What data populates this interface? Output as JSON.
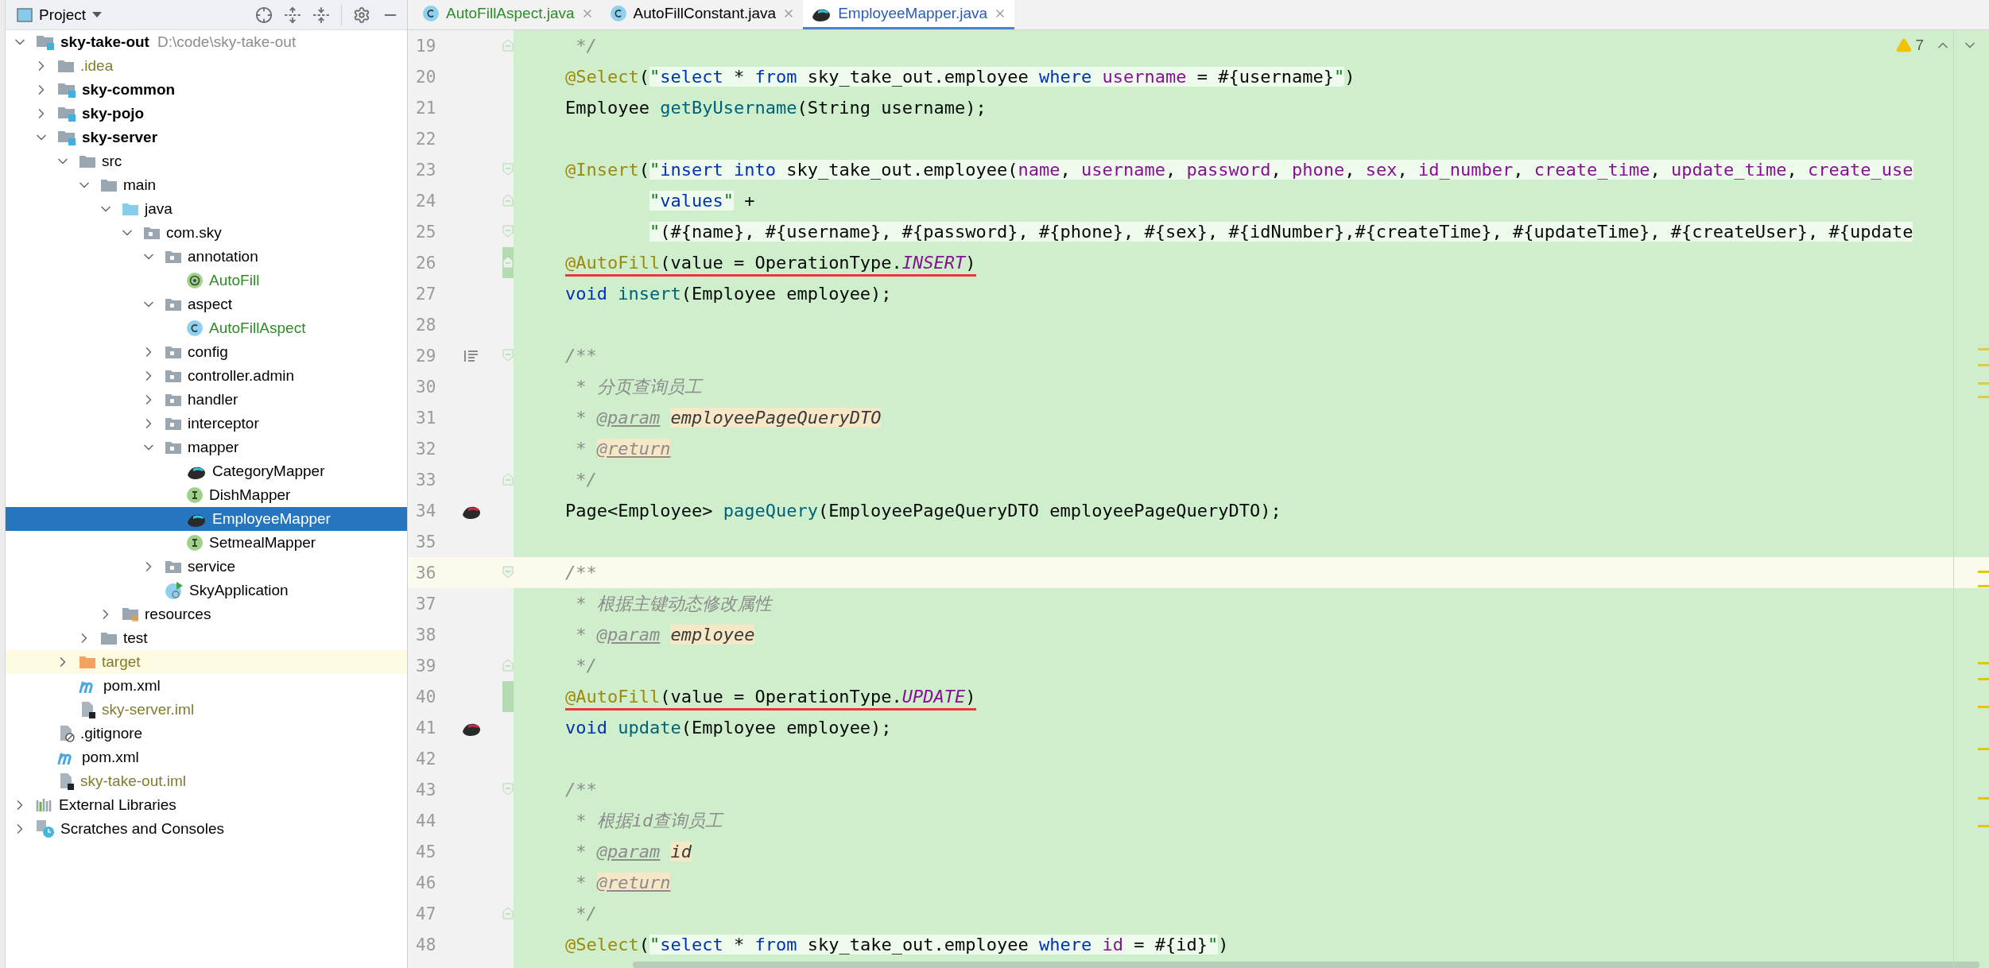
{
  "project_panel": {
    "title": "Project",
    "tree": [
      {
        "label": "sky-take-out",
        "location": "D:\\code\\sky-take-out",
        "kind": "module",
        "expanded": true,
        "selected": false,
        "children": [
          {
            "label": ".idea",
            "kind": "folder",
            "color": "#827b2d",
            "expanded": false,
            "selected": false
          },
          {
            "label": "sky-common",
            "kind": "module",
            "expanded": false,
            "selected": false
          },
          {
            "label": "sky-pojo",
            "kind": "module",
            "expanded": false,
            "selected": false
          },
          {
            "label": "sky-server",
            "kind": "module",
            "expanded": true,
            "selected": false,
            "children": [
              {
                "label": "src",
                "kind": "folder",
                "expanded": true,
                "selected": false,
                "children": [
                  {
                    "label": "main",
                    "kind": "folder",
                    "expanded": true,
                    "selected": false,
                    "children": [
                      {
                        "label": "java",
                        "kind": "source",
                        "expanded": true,
                        "selected": false,
                        "children": [
                          {
                            "label": "com.sky",
                            "kind": "package",
                            "expanded": true,
                            "selected": false,
                            "children": [
                              {
                                "label": "annotation",
                                "kind": "package",
                                "expanded": true,
                                "selected": false,
                                "children": [
                                  {
                                    "label": "AutoFill",
                                    "kind": "annotation",
                                    "color": "#2f8a2a",
                                    "selected": false
                                  }
                                ]
                              },
                              {
                                "label": "aspect",
                                "kind": "package",
                                "expanded": true,
                                "selected": false,
                                "children": [
                                  {
                                    "label": "AutoFillAspect",
                                    "kind": "class",
                                    "color": "#2f8a2a",
                                    "selected": false
                                  }
                                ]
                              },
                              {
                                "label": "config",
                                "kind": "package",
                                "expanded": false,
                                "selected": false
                              },
                              {
                                "label": "controller.admin",
                                "kind": "package",
                                "expanded": false,
                                "selected": false
                              },
                              {
                                "label": "handler",
                                "kind": "package",
                                "expanded": false,
                                "selected": false
                              },
                              {
                                "label": "interceptor",
                                "kind": "package",
                                "expanded": false,
                                "selected": false
                              },
                              {
                                "label": "mapper",
                                "kind": "package",
                                "expanded": true,
                                "selected": false,
                                "children": [
                                  {
                                    "label": "CategoryMapper",
                                    "kind": "mapper",
                                    "selected": false
                                  },
                                  {
                                    "label": "DishMapper",
                                    "kind": "interface",
                                    "selected": false
                                  },
                                  {
                                    "label": "EmployeeMapper",
                                    "kind": "mapper",
                                    "selected": true
                                  },
                                  {
                                    "label": "SetmealMapper",
                                    "kind": "interface",
                                    "selected": false
                                  }
                                ]
                              },
                              {
                                "label": "service",
                                "kind": "package",
                                "expanded": false,
                                "selected": false
                              },
                              {
                                "label": "SkyApplication",
                                "kind": "main",
                                "selected": false
                              }
                            ]
                          }
                        ]
                      },
                      {
                        "label": "resources",
                        "kind": "resources",
                        "expanded": false,
                        "selected": false
                      }
                    ]
                  },
                  {
                    "label": "test",
                    "kind": "folder",
                    "expanded": false,
                    "selected": false
                  }
                ]
              },
              {
                "label": "target",
                "kind": "excluded",
                "color": "#827b2d",
                "expanded": false,
                "selected": false
              },
              {
                "label": "pom.xml",
                "kind": "maven",
                "selected": false
              },
              {
                "label": "sky-server.iml",
                "kind": "iml",
                "color": "#827b2d",
                "selected": false
              }
            ]
          },
          {
            "label": ".gitignore",
            "kind": "gitignore",
            "selected": false
          },
          {
            "label": "pom.xml",
            "kind": "maven",
            "selected": false
          },
          {
            "label": "sky-take-out.iml",
            "kind": "iml",
            "color": "#827b2d",
            "selected": false
          }
        ]
      },
      {
        "label": "External Libraries",
        "kind": "libraries",
        "expanded": false,
        "selected": false
      },
      {
        "label": "Scratches and Consoles",
        "kind": "scratches",
        "expanded": false,
        "selected": false
      }
    ]
  },
  "editor": {
    "tabs": [
      {
        "label": "AutoFillAspect.java",
        "kind": "class",
        "color": "#2f8a2a",
        "selected": false
      },
      {
        "label": "AutoFillConstant.java",
        "kind": "class",
        "selected": false
      },
      {
        "label": "EmployeeMapper.java",
        "kind": "mapper",
        "color": "#2a5cb6",
        "selected": true
      }
    ],
    "warning_count": "7",
    "lines": [
      {
        "number": "19",
        "current": false,
        "modified": false,
        "fold_start": false,
        "fold_end": true,
        "mapped": false,
        "render_toggle": false,
        "tokens": [
          {
            "kind": "cmt",
            "text": "     */"
          }
        ]
      },
      {
        "number": "20",
        "current": false,
        "modified": false,
        "fold_start": false,
        "fold_end": false,
        "mapped": false,
        "render_toggle": false,
        "tokens": [
          {
            "kind": "ann",
            "text": "    @Select"
          },
          {
            "kind": "plain",
            "text": "("
          },
          {
            "kind": "str",
            "text": "\""
          },
          {
            "kind": "sqlkw",
            "text": "select"
          },
          {
            "kind": "sql",
            "text": " * "
          },
          {
            "kind": "sqlkw",
            "text": "from"
          },
          {
            "kind": "sql",
            "text": " sky_take_out.employee "
          },
          {
            "kind": "sqlkw",
            "text": "where"
          },
          {
            "kind": "col",
            "text": " username"
          },
          {
            "kind": "sql",
            "text": " = #{username}"
          },
          {
            "kind": "str",
            "text": "\""
          },
          {
            "kind": "plain",
            "text": ")"
          }
        ]
      },
      {
        "number": "21",
        "current": false,
        "modified": false,
        "fold_start": false,
        "fold_end": false,
        "mapped": false,
        "render_toggle": false,
        "tokens": [
          {
            "kind": "plain",
            "text": "    Employee "
          },
          {
            "kind": "fn",
            "text": "getByUsername"
          },
          {
            "kind": "plain",
            "text": "(String username);"
          }
        ]
      },
      {
        "number": "22",
        "current": false,
        "modified": false,
        "fold_start": false,
        "fold_end": false,
        "mapped": false,
        "render_toggle": false
      },
      {
        "number": "23",
        "current": false,
        "modified": false,
        "fold_start": true,
        "fold_end": false,
        "mapped": false,
        "render_toggle": false,
        "tokens": [
          {
            "kind": "ann",
            "text": "    @Insert"
          },
          {
            "kind": "plain",
            "text": "("
          },
          {
            "kind": "str",
            "text": "\""
          },
          {
            "kind": "sqlkw",
            "text": "insert into"
          },
          {
            "kind": "sql",
            "text": " sky_take_out.employee("
          },
          {
            "kind": "col",
            "text": "name"
          },
          {
            "kind": "sql",
            "text": ", "
          },
          {
            "kind": "col",
            "text": "username"
          },
          {
            "kind": "sql",
            "text": ", "
          },
          {
            "kind": "col",
            "text": "password"
          },
          {
            "kind": "sql",
            "text": ", "
          },
          {
            "kind": "col",
            "text": "phone"
          },
          {
            "kind": "sql",
            "text": ", "
          },
          {
            "kind": "col",
            "text": "sex"
          },
          {
            "kind": "sql",
            "text": ", "
          },
          {
            "kind": "col",
            "text": "id_number"
          },
          {
            "kind": "sql",
            "text": ", "
          },
          {
            "kind": "col",
            "text": "create_time"
          },
          {
            "kind": "sql",
            "text": ", "
          },
          {
            "kind": "col",
            "text": "update_time"
          },
          {
            "kind": "sql",
            "text": ", "
          },
          {
            "kind": "col",
            "text": "create_use"
          }
        ]
      },
      {
        "number": "24",
        "current": false,
        "modified": false,
        "fold_start": false,
        "fold_end": true,
        "mapped": false,
        "render_toggle": false,
        "tokens": [
          {
            "kind": "str",
            "text": "            \""
          },
          {
            "kind": "sqlkw",
            "text": "values"
          },
          {
            "kind": "str",
            "text": "\""
          },
          {
            "kind": "plain",
            "text": " +"
          }
        ]
      },
      {
        "number": "25",
        "current": false,
        "modified": false,
        "fold_start": true,
        "fold_end": false,
        "mapped": false,
        "render_toggle": false,
        "tokens": [
          {
            "kind": "str",
            "text": "            \""
          },
          {
            "kind": "sql",
            "text": "(#{name}, #{username}, #{password}, #{phone}, #{sex}, #{idNumber},#{createTime}, #{updateTime}, #{createUser}, #{update"
          }
        ]
      },
      {
        "number": "26",
        "current": false,
        "modified": true,
        "underlined": true,
        "fold_start": false,
        "fold_end": true,
        "mapped": false,
        "render_toggle": false,
        "tokens": [
          {
            "kind": "ann",
            "text": "    @AutoFill"
          },
          {
            "kind": "plain",
            "text": "(value = OperationType."
          },
          {
            "kind": "const",
            "text": "INSERT"
          },
          {
            "kind": "plain",
            "text": ")"
          }
        ]
      },
      {
        "number": "27",
        "current": false,
        "modified": false,
        "fold_start": false,
        "fold_end": false,
        "mapped": false,
        "render_toggle": false,
        "tokens": [
          {
            "kind": "kw",
            "text": "    void"
          },
          {
            "kind": "fn",
            "text": " insert"
          },
          {
            "kind": "plain",
            "text": "(Employee employee);"
          }
        ]
      },
      {
        "number": "28",
        "current": false,
        "modified": false,
        "fold_start": false,
        "fold_end": false,
        "mapped": false,
        "render_toggle": false
      },
      {
        "number": "29",
        "current": false,
        "modified": false,
        "fold_start": true,
        "fold_end": false,
        "mapped": false,
        "render_toggle": true,
        "tokens": [
          {
            "kind": "cmt",
            "text": "    /**"
          }
        ]
      },
      {
        "number": "30",
        "current": false,
        "modified": false,
        "fold_start": false,
        "fold_end": false,
        "mapped": false,
        "render_toggle": false,
        "tokens": [
          {
            "kind": "cmt",
            "text": "     * 分页查询员工"
          }
        ]
      },
      {
        "number": "31",
        "current": false,
        "modified": false,
        "fold_start": false,
        "fold_end": false,
        "mapped": false,
        "render_toggle": false,
        "tokens": [
          {
            "kind": "cmt",
            "text": "     * "
          },
          {
            "kind": "tag",
            "text": "@param"
          },
          {
            "kind": "arg",
            "text": " employeePageQueryDTO"
          }
        ]
      },
      {
        "number": "32",
        "current": false,
        "modified": false,
        "fold_start": false,
        "fold_end": false,
        "mapped": false,
        "render_toggle": false,
        "tokens": [
          {
            "kind": "cmt",
            "text": "     * "
          },
          {
            "kind": "tagw",
            "text": "@return"
          }
        ]
      },
      {
        "number": "33",
        "current": false,
        "modified": false,
        "fold_start": false,
        "fold_end": true,
        "mapped": false,
        "render_toggle": false,
        "tokens": [
          {
            "kind": "cmt",
            "text": "     */"
          }
        ]
      },
      {
        "number": "34",
        "current": false,
        "modified": false,
        "fold_start": false,
        "fold_end": false,
        "mapped": true,
        "render_toggle": false,
        "tokens": [
          {
            "kind": "plain",
            "text": "    Page<Employee> "
          },
          {
            "kind": "fn",
            "text": "pageQuery"
          },
          {
            "kind": "plain",
            "text": "(EmployeePageQueryDTO employeePageQueryDTO);"
          }
        ]
      },
      {
        "number": "35",
        "current": false,
        "modified": false,
        "fold_start": false,
        "fold_end": false,
        "mapped": false,
        "render_toggle": false
      },
      {
        "number": "36",
        "current": true,
        "modified": false,
        "fold_start": true,
        "fold_end": false,
        "mapped": false,
        "render_toggle": false,
        "tokens": [
          {
            "kind": "cmt",
            "text": "    /**"
          }
        ]
      },
      {
        "number": "37",
        "current": false,
        "modified": false,
        "fold_start": false,
        "fold_end": false,
        "mapped": false,
        "render_toggle": false,
        "tokens": [
          {
            "kind": "cmt",
            "text": "     * 根据主键动态修改属性"
          }
        ]
      },
      {
        "number": "38",
        "current": false,
        "modified": false,
        "fold_start": false,
        "fold_end": false,
        "mapped": false,
        "render_toggle": false,
        "tokens": [
          {
            "kind": "cmt",
            "text": "     * "
          },
          {
            "kind": "tag",
            "text": "@param"
          },
          {
            "kind": "arg",
            "text": " employee"
          }
        ]
      },
      {
        "number": "39",
        "current": false,
        "modified": false,
        "fold_start": false,
        "fold_end": true,
        "mapped": false,
        "render_toggle": false,
        "tokens": [
          {
            "kind": "cmt",
            "text": "     */"
          }
        ]
      },
      {
        "number": "40",
        "current": false,
        "modified": true,
        "underlined": true,
        "fold_start": false,
        "fold_end": false,
        "mapped": false,
        "render_toggle": false,
        "tokens": [
          {
            "kind": "ann",
            "text": "    @AutoFill"
          },
          {
            "kind": "plain",
            "text": "(value = OperationType."
          },
          {
            "kind": "const",
            "text": "UPDATE"
          },
          {
            "kind": "plain",
            "text": ")"
          }
        ]
      },
      {
        "number": "41",
        "current": false,
        "modified": false,
        "fold_start": false,
        "fold_end": false,
        "mapped": true,
        "render_toggle": false,
        "tokens": [
          {
            "kind": "kw",
            "text": "    void"
          },
          {
            "kind": "fn",
            "text": " update"
          },
          {
            "kind": "plain",
            "text": "(Employee employee);"
          }
        ]
      },
      {
        "number": "42",
        "current": false,
        "modified": false,
        "fold_start": false,
        "fold_end": false,
        "mapped": false,
        "render_toggle": false
      },
      {
        "number": "43",
        "current": false,
        "modified": false,
        "fold_start": true,
        "fold_end": false,
        "mapped": false,
        "render_toggle": false,
        "tokens": [
          {
            "kind": "cmt",
            "text": "    /**"
          }
        ]
      },
      {
        "number": "44",
        "current": false,
        "modified": false,
        "fold_start": false,
        "fold_end": false,
        "mapped": false,
        "render_toggle": false,
        "tokens": [
          {
            "kind": "cmt",
            "text": "     * 根据id查询员工"
          }
        ]
      },
      {
        "number": "45",
        "current": false,
        "modified": false,
        "fold_start": false,
        "fold_end": false,
        "mapped": false,
        "render_toggle": false,
        "tokens": [
          {
            "kind": "cmt",
            "text": "     * "
          },
          {
            "kind": "tag",
            "text": "@param"
          },
          {
            "kind": "arg",
            "text": " id"
          }
        ]
      },
      {
        "number": "46",
        "current": false,
        "modified": false,
        "fold_start": false,
        "fold_end": false,
        "mapped": false,
        "render_toggle": false,
        "tokens": [
          {
            "kind": "cmt",
            "text": "     * "
          },
          {
            "kind": "tagw",
            "text": "@return"
          }
        ]
      },
      {
        "number": "47",
        "current": false,
        "modified": false,
        "fold_start": false,
        "fold_end": true,
        "mapped": false,
        "render_toggle": false,
        "tokens": [
          {
            "kind": "cmt",
            "text": "     */"
          }
        ]
      },
      {
        "number": "48",
        "current": false,
        "modified": false,
        "fold_start": false,
        "fold_end": false,
        "mapped": false,
        "render_toggle": false,
        "tokens": [
          {
            "kind": "ann",
            "text": "    @Select"
          },
          {
            "kind": "plain",
            "text": "("
          },
          {
            "kind": "str",
            "text": "\""
          },
          {
            "kind": "sqlkw",
            "text": "select"
          },
          {
            "kind": "sql",
            "text": " * "
          },
          {
            "kind": "sqlkw",
            "text": "from"
          },
          {
            "kind": "sql",
            "text": " sky_take_out.employee "
          },
          {
            "kind": "sqlkw",
            "text": "where"
          },
          {
            "kind": "col",
            "text": " id"
          },
          {
            "kind": "sql",
            "text": " = #{id}"
          },
          {
            "kind": "str",
            "text": "\""
          },
          {
            "kind": "plain",
            "text": ")"
          }
        ]
      }
    ]
  }
}
